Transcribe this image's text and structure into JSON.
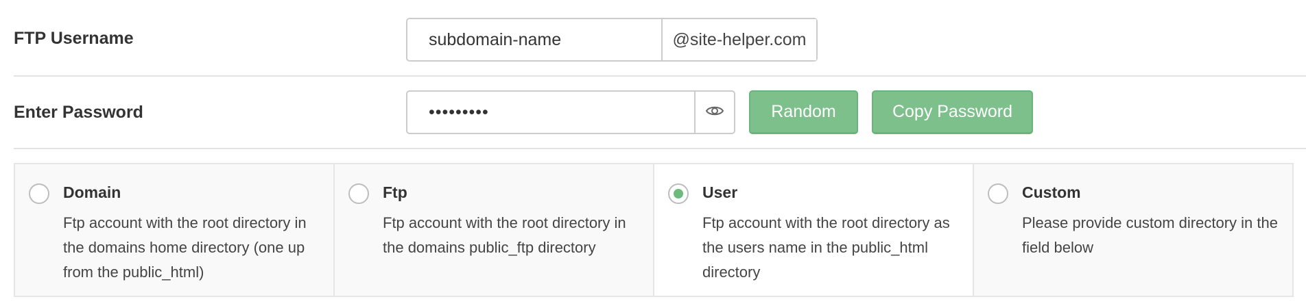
{
  "ftp_username": {
    "label": "FTP Username",
    "value": "subdomain-name",
    "suffix": "@site-helper.com"
  },
  "password": {
    "label": "Enter Password",
    "masked_value": "•••••••••",
    "toggle_icon": "eye-icon",
    "random_label": "Random",
    "copy_label": "Copy Password"
  },
  "accent_color": "#7dc08c",
  "directory_options": [
    {
      "title": "Domain",
      "description": "Ftp account with the root directory in the domains home directory (one up from the public_html)",
      "selected": false
    },
    {
      "title": "Ftp",
      "description": "Ftp account with the root directory in the domains public_ftp directory",
      "selected": false
    },
    {
      "title": "User",
      "description": "Ftp account with the root directory as the users name in the public_html directory",
      "selected": true
    },
    {
      "title": "Custom",
      "description": "Please provide custom directory in the field below",
      "selected": false
    }
  ]
}
